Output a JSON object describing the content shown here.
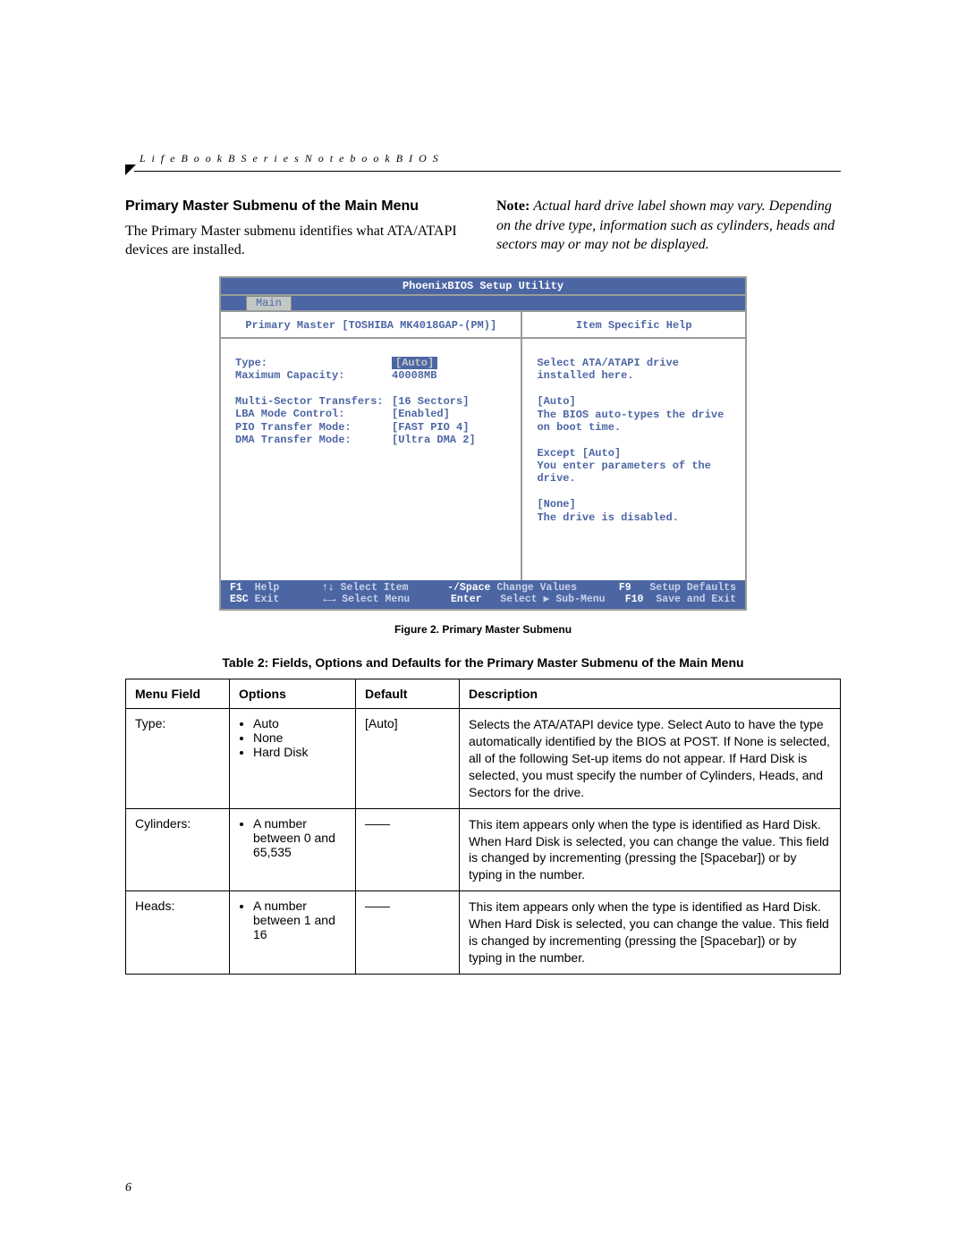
{
  "bookTitle": "L i f e B o o k   B   S e r i e s   N o t e b o o k   B I O S",
  "sectionHeading": "Primary Master Submenu of the Main Menu",
  "introText": "The Primary Master submenu identifies what ATA/ATAPI devices are installed.",
  "noteLabel": "Note:",
  "noteBody": "Actual hard drive label shown may vary. Depending on the drive type, information such as cylinders, heads and sectors may or may not be displayed.",
  "bios": {
    "title": "PhoenixBIOS Setup Utility",
    "tab": "Main",
    "leftHeader": "Primary Master [TOSHIBA MK4018GAP-(PM)]",
    "rightHeader": "Item Specific Help",
    "fields": {
      "type": {
        "label": "Type:",
        "value": "Auto",
        "selected": true
      },
      "maxcap": {
        "label": "Maximum Capacity:",
        "value": "40008MB"
      },
      "multi": {
        "label": "Multi-Sector Transfers:",
        "value": "[16 Sectors]"
      },
      "lba": {
        "label": "LBA Mode Control:",
        "value": "[Enabled]"
      },
      "pio": {
        "label": "PIO Transfer Mode:",
        "value": "[FAST PIO 4]"
      },
      "dma": {
        "label": "DMA Transfer Mode:",
        "value": "[Ultra DMA 2]"
      }
    },
    "helpText": "Select ATA/ATAPI drive installed here.\n\n[Auto]\nThe BIOS auto-types the drive on boot time.\n\nExcept [Auto]\nYou enter parameters of the drive.\n\n[None]\nThe drive is disabled.",
    "footer": {
      "row1": {
        "a_key": "F1",
        "a_lbl": "Help",
        "b_key": "↑↓",
        "b_lbl": "Select Item",
        "c_key": "-/Space",
        "c_lbl": "Change Values",
        "d_key": "F9",
        "d_lbl": "Setup Defaults"
      },
      "row2": {
        "a_key": "ESC",
        "a_lbl": "Exit",
        "b_key": "←→",
        "b_lbl": "Select Menu",
        "c_key": "Enter",
        "c_lbl": "Select ▶ Sub-Menu",
        "d_key": "F10",
        "d_lbl": "Save and Exit"
      }
    }
  },
  "figureCaption": "Figure 2.  Primary Master Submenu",
  "tableCaption": "Table 2: Fields, Options and Defaults for the Primary Master Submenu of the Main Menu",
  "tableHeaders": {
    "field": "Menu Field",
    "options": "Options",
    "default": "Default",
    "description": "Description"
  },
  "rows": [
    {
      "field": "Type:",
      "options": [
        "Auto",
        "None",
        "Hard Disk"
      ],
      "default": "[Auto]",
      "description": "Selects the ATA/ATAPI device type. Select Auto to have the type automatically identified by the BIOS at POST. If None is selected, all of the following Set-up items do not appear. If Hard Disk is selected, you must specify the number of Cylinders, Heads, and Sectors for the drive."
    },
    {
      "field": "Cylinders:",
      "options": [
        "A number between 0 and 65,535"
      ],
      "default": "——",
      "description": "This item appears only when the type is identified as Hard Disk. When Hard Disk is selected, you can change the value. This field is changed by incrementing (pressing the [Spacebar]) or by typing in the number."
    },
    {
      "field": "Heads:",
      "options": [
        "A number between 1 and 16"
      ],
      "default": "——",
      "description": "This item appears only when the type is identified as Hard Disk. When Hard Disk is selected, you can change the value. This field is changed by incrementing (pressing the [Spacebar]) or by typing in the number."
    }
  ],
  "pageNumber": "6"
}
